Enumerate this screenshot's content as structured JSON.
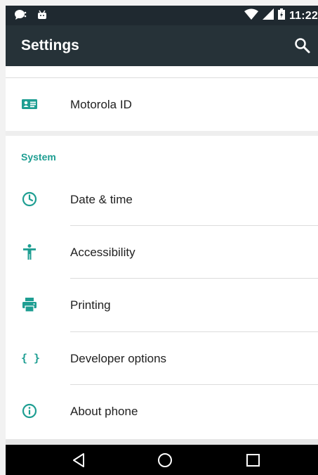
{
  "status_bar": {
    "time": "11:22",
    "left_icons": [
      "chat-notification-icon",
      "android-notification-icon"
    ],
    "right_icons": [
      "wifi-icon",
      "cell-signal-icon",
      "battery-charging-icon"
    ]
  },
  "toolbar": {
    "title": "Settings",
    "search_icon": "search-icon"
  },
  "items_top": [
    {
      "label": "Motorola ID",
      "icon": "motorola-id-icon"
    }
  ],
  "system_section": {
    "header": "System",
    "items": [
      {
        "label": "Date & time",
        "icon": "clock-icon"
      },
      {
        "label": "Accessibility",
        "icon": "accessibility-icon"
      },
      {
        "label": "Printing",
        "icon": "printer-icon"
      },
      {
        "label": "Developer options",
        "icon": "developer-options-icon",
        "glyph": "{ }"
      },
      {
        "label": "About phone",
        "icon": "info-icon"
      }
    ]
  },
  "nav_bar": {
    "buttons": [
      "back-icon",
      "home-icon",
      "recents-icon"
    ]
  },
  "colors": {
    "accent": "#1e9e92",
    "toolbar": "#263238",
    "status_bar": "#1f2930",
    "nav_bar": "#000000"
  }
}
